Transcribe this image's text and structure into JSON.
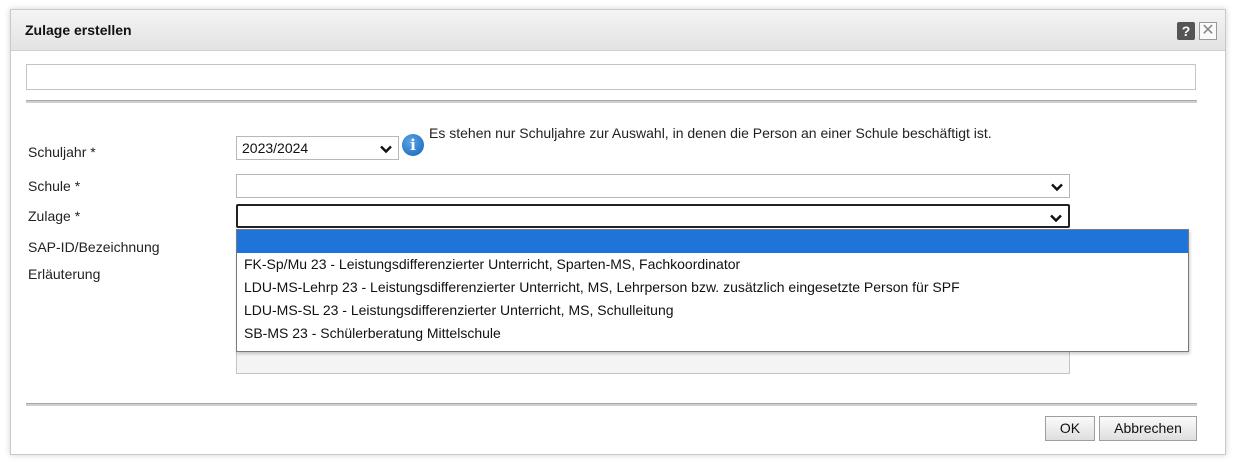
{
  "dialog": {
    "title": "Zulage erstellen",
    "help_label": "?",
    "close_label": "✕"
  },
  "form": {
    "schuljahr_label": "Schuljahr *",
    "schuljahr_value": "2023/2024",
    "info_text": "Es stehen nur Schuljahre zur Auswahl, in denen die Person an einer Schule beschäftigt ist.",
    "schule_label": "Schule *",
    "zulage_label": "Zulage *",
    "sap_label": "SAP-ID/Bezeichnung",
    "erlaeuterung_label": "Erläuterung"
  },
  "dropdown": {
    "options": [
      "",
      "FK-Sp/Mu 23 - Leistungsdifferenzierter Unterricht, Sparten-MS, Fachkoordinator",
      "LDU-MS-Lehrp 23 - Leistungsdifferenzierter Unterricht, MS, Lehrperson bzw. zusätzlich eingesetzte Person für SPF",
      "LDU-MS-SL 23 - Leistungsdifferenzierter Unterricht, MS, Schulleitung",
      "SB-MS 23 - Schülerberatung Mittelschule"
    ]
  },
  "buttons": {
    "ok": "OK",
    "cancel": "Abbrechen"
  },
  "colors": {
    "selection": "#1e74d8",
    "info_icon": "#1560b8"
  }
}
